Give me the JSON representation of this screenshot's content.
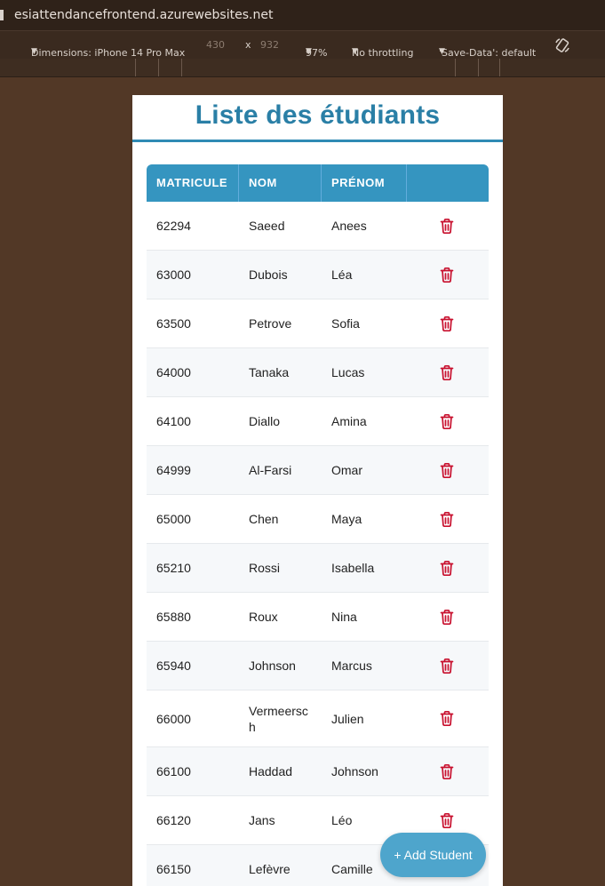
{
  "browser": {
    "url": "esiattendancefrontend.azurewebsites.net"
  },
  "devtools": {
    "device_label": "Dimensions: iPhone 14 Pro Max",
    "width": "430",
    "times": "x",
    "height": "932",
    "zoom": "97%",
    "throttling": "No throttling",
    "save_data": "'Save-Data': default"
  },
  "page": {
    "title": "Liste des étudiants",
    "accent": "#2f8ab4",
    "header_bg": "#3595c0",
    "delete_color": "#c8102e"
  },
  "table": {
    "columns": [
      "MATRICULE",
      "NOM",
      "PRÉNOM",
      ""
    ],
    "rows": [
      {
        "matricule": "62294",
        "nom": "Saeed",
        "prenom": "Anees"
      },
      {
        "matricule": "63000",
        "nom": "Dubois",
        "prenom": "Léa"
      },
      {
        "matricule": "63500",
        "nom": "Petrove",
        "prenom": "Sofia"
      },
      {
        "matricule": "64000",
        "nom": "Tanaka",
        "prenom": "Lucas"
      },
      {
        "matricule": "64100",
        "nom": "Diallo",
        "prenom": "Amina"
      },
      {
        "matricule": "64999",
        "nom": "Al-Farsi",
        "prenom": "Omar"
      },
      {
        "matricule": "65000",
        "nom": "Chen",
        "prenom": "Maya"
      },
      {
        "matricule": "65210",
        "nom": "Rossi",
        "prenom": "Isabella"
      },
      {
        "matricule": "65880",
        "nom": "Roux",
        "prenom": "Nina"
      },
      {
        "matricule": "65940",
        "nom": "Johnson",
        "prenom": "Marcus"
      },
      {
        "matricule": "66000",
        "nom": "Vermeersch",
        "prenom": "Julien"
      },
      {
        "matricule": "66100",
        "nom": "Haddad",
        "prenom": "Johnson"
      },
      {
        "matricule": "66120",
        "nom": "Jans",
        "prenom": "Léo"
      },
      {
        "matricule": "66150",
        "nom": "Lefèvre",
        "prenom": "Camille"
      }
    ],
    "row_action_icon": "trash-icon"
  },
  "fab": {
    "label": "+ Add Student"
  }
}
